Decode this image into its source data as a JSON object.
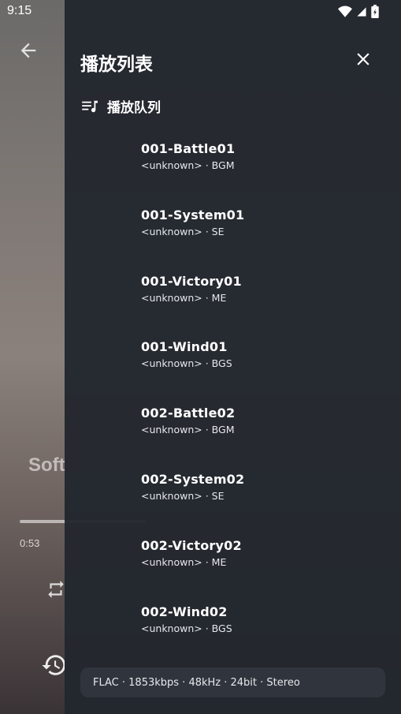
{
  "status_bar": {
    "time": "9:15"
  },
  "background_player": {
    "song_title_partial": "Soft",
    "elapsed_time": "0:53"
  },
  "drawer": {
    "title": "播放列表",
    "queue_label": "播放队列",
    "tracks": [
      {
        "title": "001-Battle01",
        "subtitle": "<unknown> · BGM"
      },
      {
        "title": "001-System01",
        "subtitle": "<unknown> · SE"
      },
      {
        "title": "001-Victory01",
        "subtitle": "<unknown> · ME"
      },
      {
        "title": "001-Wind01",
        "subtitle": "<unknown> · BGS"
      },
      {
        "title": "002-Battle02",
        "subtitle": "<unknown> · BGM"
      },
      {
        "title": "002-System02",
        "subtitle": "<unknown> · SE"
      },
      {
        "title": "002-Victory02",
        "subtitle": "<unknown> · ME"
      },
      {
        "title": "002-Wind02",
        "subtitle": "<unknown> · BGS"
      }
    ],
    "format_info": "FLAC · 1853kbps · 48kHz · 24bit · Stereo"
  }
}
